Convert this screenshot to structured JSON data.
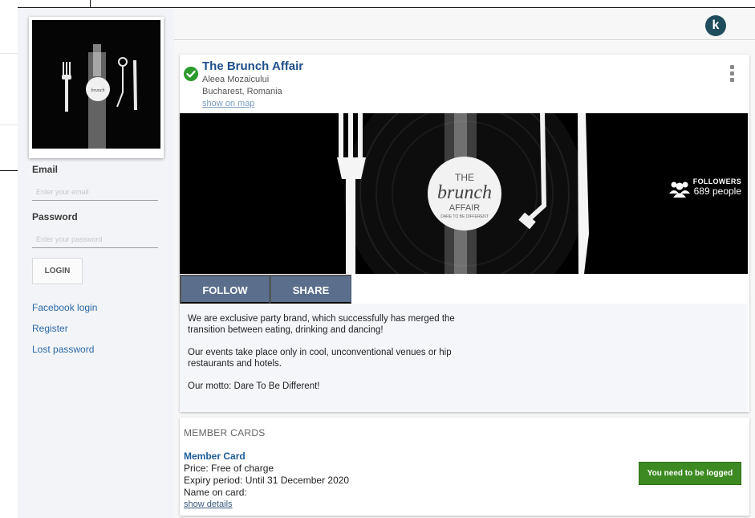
{
  "sidebar": {
    "email_label": "Email",
    "email_placeholder": "Enter your email",
    "password_label": "Password",
    "password_placeholder": "Enter your password",
    "login_label": "LOGIN",
    "links": [
      "Facebook login",
      "Register",
      "Lost password"
    ]
  },
  "header": {
    "badge": "k"
  },
  "venue": {
    "name": "The Brunch Affair",
    "street": "Aleea Mozaicului",
    "city": "Bucharest, Romania",
    "map_link": "show on map",
    "followers_label": "FOLLOWERS",
    "followers_count": "689 people",
    "follow_label": "FOLLOW",
    "share_label": "SHARE",
    "logo_text": {
      "the": "THE",
      "brunch": "brunch",
      "affair": "AFFAIR",
      "tagline": "DARE TO BE DIFFERENT"
    },
    "description": [
      "We are exclusive party brand, which successfully has merged the transition between eating, drinking and dancing!",
      "Our events take place only in cool, unconventional venues or hip restaurants and hotels.",
      "Our motto: Dare To Be Different!"
    ]
  },
  "member_cards": {
    "title": "MEMBER CARDS",
    "card": {
      "name": "Member Card",
      "price": "Price: Free of charge",
      "expiry": "Expiry period: Until 31 December 2020",
      "name_on_card": "Name on card:",
      "details_link": "show details",
      "action_label": "You need to be logged"
    }
  },
  "colors": {
    "accent_blue": "#1e4f8a",
    "button_slate": "#5b6f8d",
    "success_green": "#3c8a21",
    "verified_green": "#2c9a2c"
  }
}
